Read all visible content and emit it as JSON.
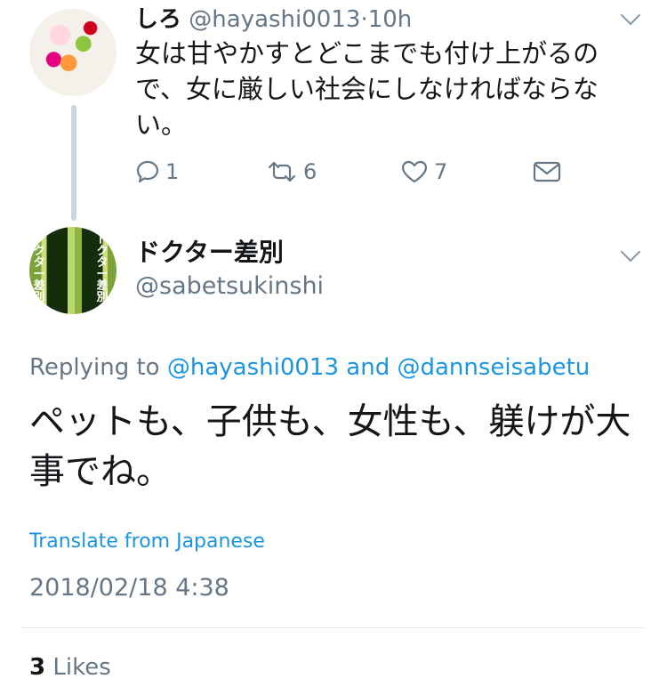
{
  "tweet1": {
    "display_name": "しろ",
    "handle": "@hayashi0013",
    "separator": "·",
    "time": "10h",
    "text": "女は甘やかすとどこまでも付け上がるので、女に厳しい社会にしなければならない。",
    "actions": {
      "reply_count": "1",
      "retweet_count": "6",
      "like_count": "7"
    }
  },
  "tweet2": {
    "display_name": "ドクター差別",
    "handle": "@sabetsukinshi",
    "avatar_text": [
      "ドクター差別",
      "ドクター差別"
    ],
    "replying_prefix": "Replying to",
    "replying_to_1": "@hayashi0013",
    "replying_and": "and",
    "replying_to_2": "@dannseisabetu",
    "text": "ペットも、子供も、女性も、躾けが大事でね。",
    "translate_label": "Translate from Japanese",
    "timestamp": "2018/02/18 4:38",
    "likes_count": "3",
    "likes_label": "Likes"
  },
  "colors": {
    "link": "#1b95e0",
    "secondary": "#657786",
    "text": "#14171a"
  },
  "icons": [
    "reply-icon",
    "retweet-icon",
    "like-icon",
    "share-icon",
    "chevron-down-icon"
  ]
}
